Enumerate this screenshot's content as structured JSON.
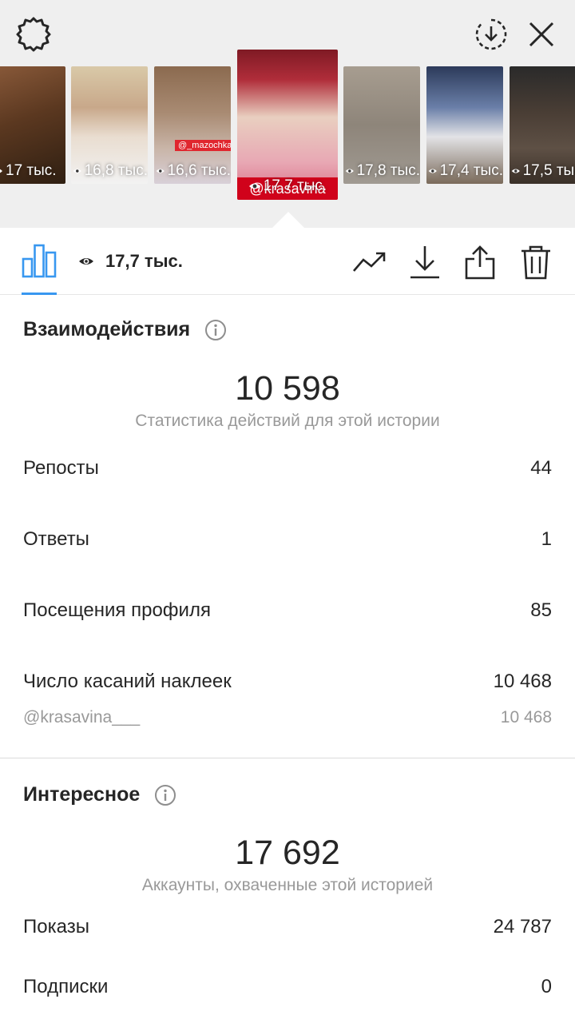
{
  "header": {
    "settings_icon": "gear-icon",
    "download_icon": "circle-download-icon",
    "close_icon": "close-icon"
  },
  "thumbnails": [
    {
      "views": "17 тыс.",
      "selected": false
    },
    {
      "views": "16,8 тыс.",
      "selected": false
    },
    {
      "views": "16,6 тыс.",
      "selected": false,
      "tag": "@_mazochka_"
    },
    {
      "views": "17,7 тыс.",
      "selected": true,
      "sticker": "@krasavina"
    },
    {
      "views": "17,8 тыс.",
      "selected": false
    },
    {
      "views": "17,4 тыс.",
      "selected": false
    },
    {
      "views": "17,5 тыс.",
      "selected": false
    }
  ],
  "toolbar": {
    "views": "17,7 тыс.",
    "icons": [
      "bar-chart-icon",
      "trend-icon",
      "download-icon",
      "share-icon",
      "trash-icon"
    ],
    "accent": "#3897f0"
  },
  "interactions": {
    "title": "Взаимодействия",
    "total": "10 598",
    "caption": "Статистика действий для этой истории",
    "rows": [
      {
        "label": "Репосты",
        "value": "44"
      },
      {
        "label": "Ответы",
        "value": "1"
      },
      {
        "label": "Посещения профиля",
        "value": "85"
      },
      {
        "label": "Число касаний наклеек",
        "value": "10 468"
      }
    ],
    "sub_row": {
      "label": "@krasavina___",
      "value": "10 468"
    }
  },
  "discovery": {
    "title": "Интересное",
    "total": "17 692",
    "caption": "Аккаунты, охваченные этой историей",
    "rows": [
      {
        "label": "Показы",
        "value": "24 787"
      },
      {
        "label": "Подписки",
        "value": "0"
      }
    ]
  }
}
